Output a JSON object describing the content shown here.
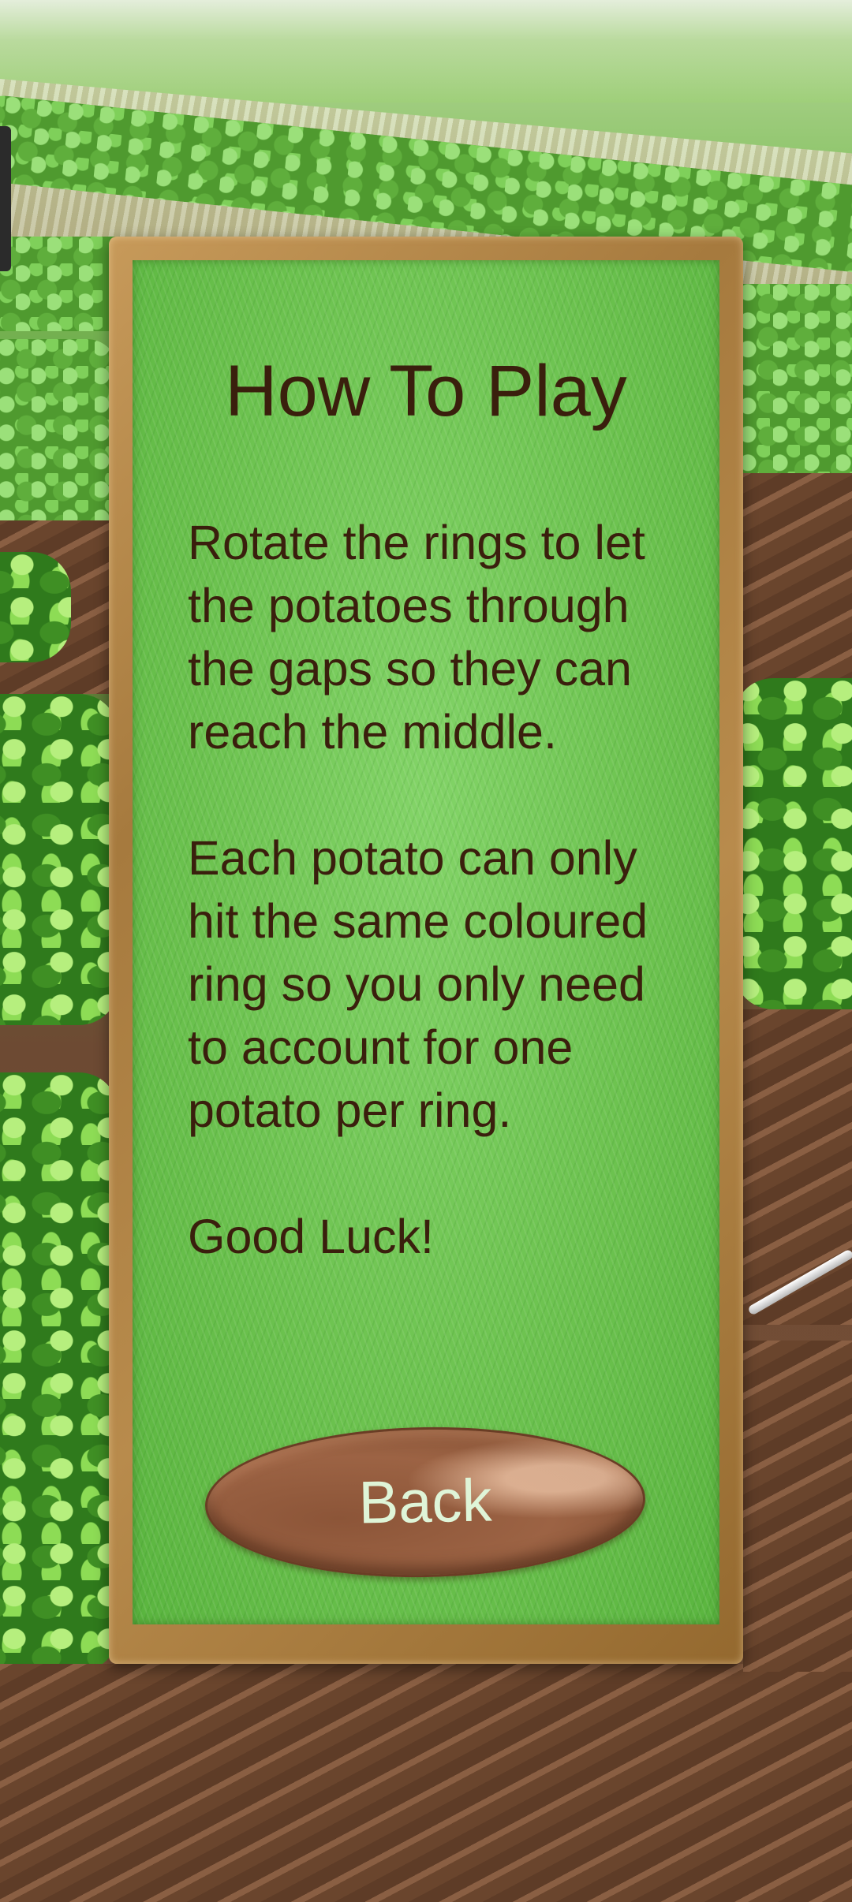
{
  "dialog": {
    "title": "How To Play",
    "paragraphs": [
      "Rotate the rings to let the potatoes through the gaps so they can reach the middle.",
      "Each potato can only hit the same coloured ring so you only need to account for one potato per ring.",
      "Good Luck!"
    ],
    "back_label": "Back"
  },
  "colors": {
    "text": "#3a1f0d",
    "button_text": "#dff5d8",
    "panel_green": "#6cc24f",
    "frame_gold": "#b88b4c",
    "button_brown": "#9c6344"
  }
}
